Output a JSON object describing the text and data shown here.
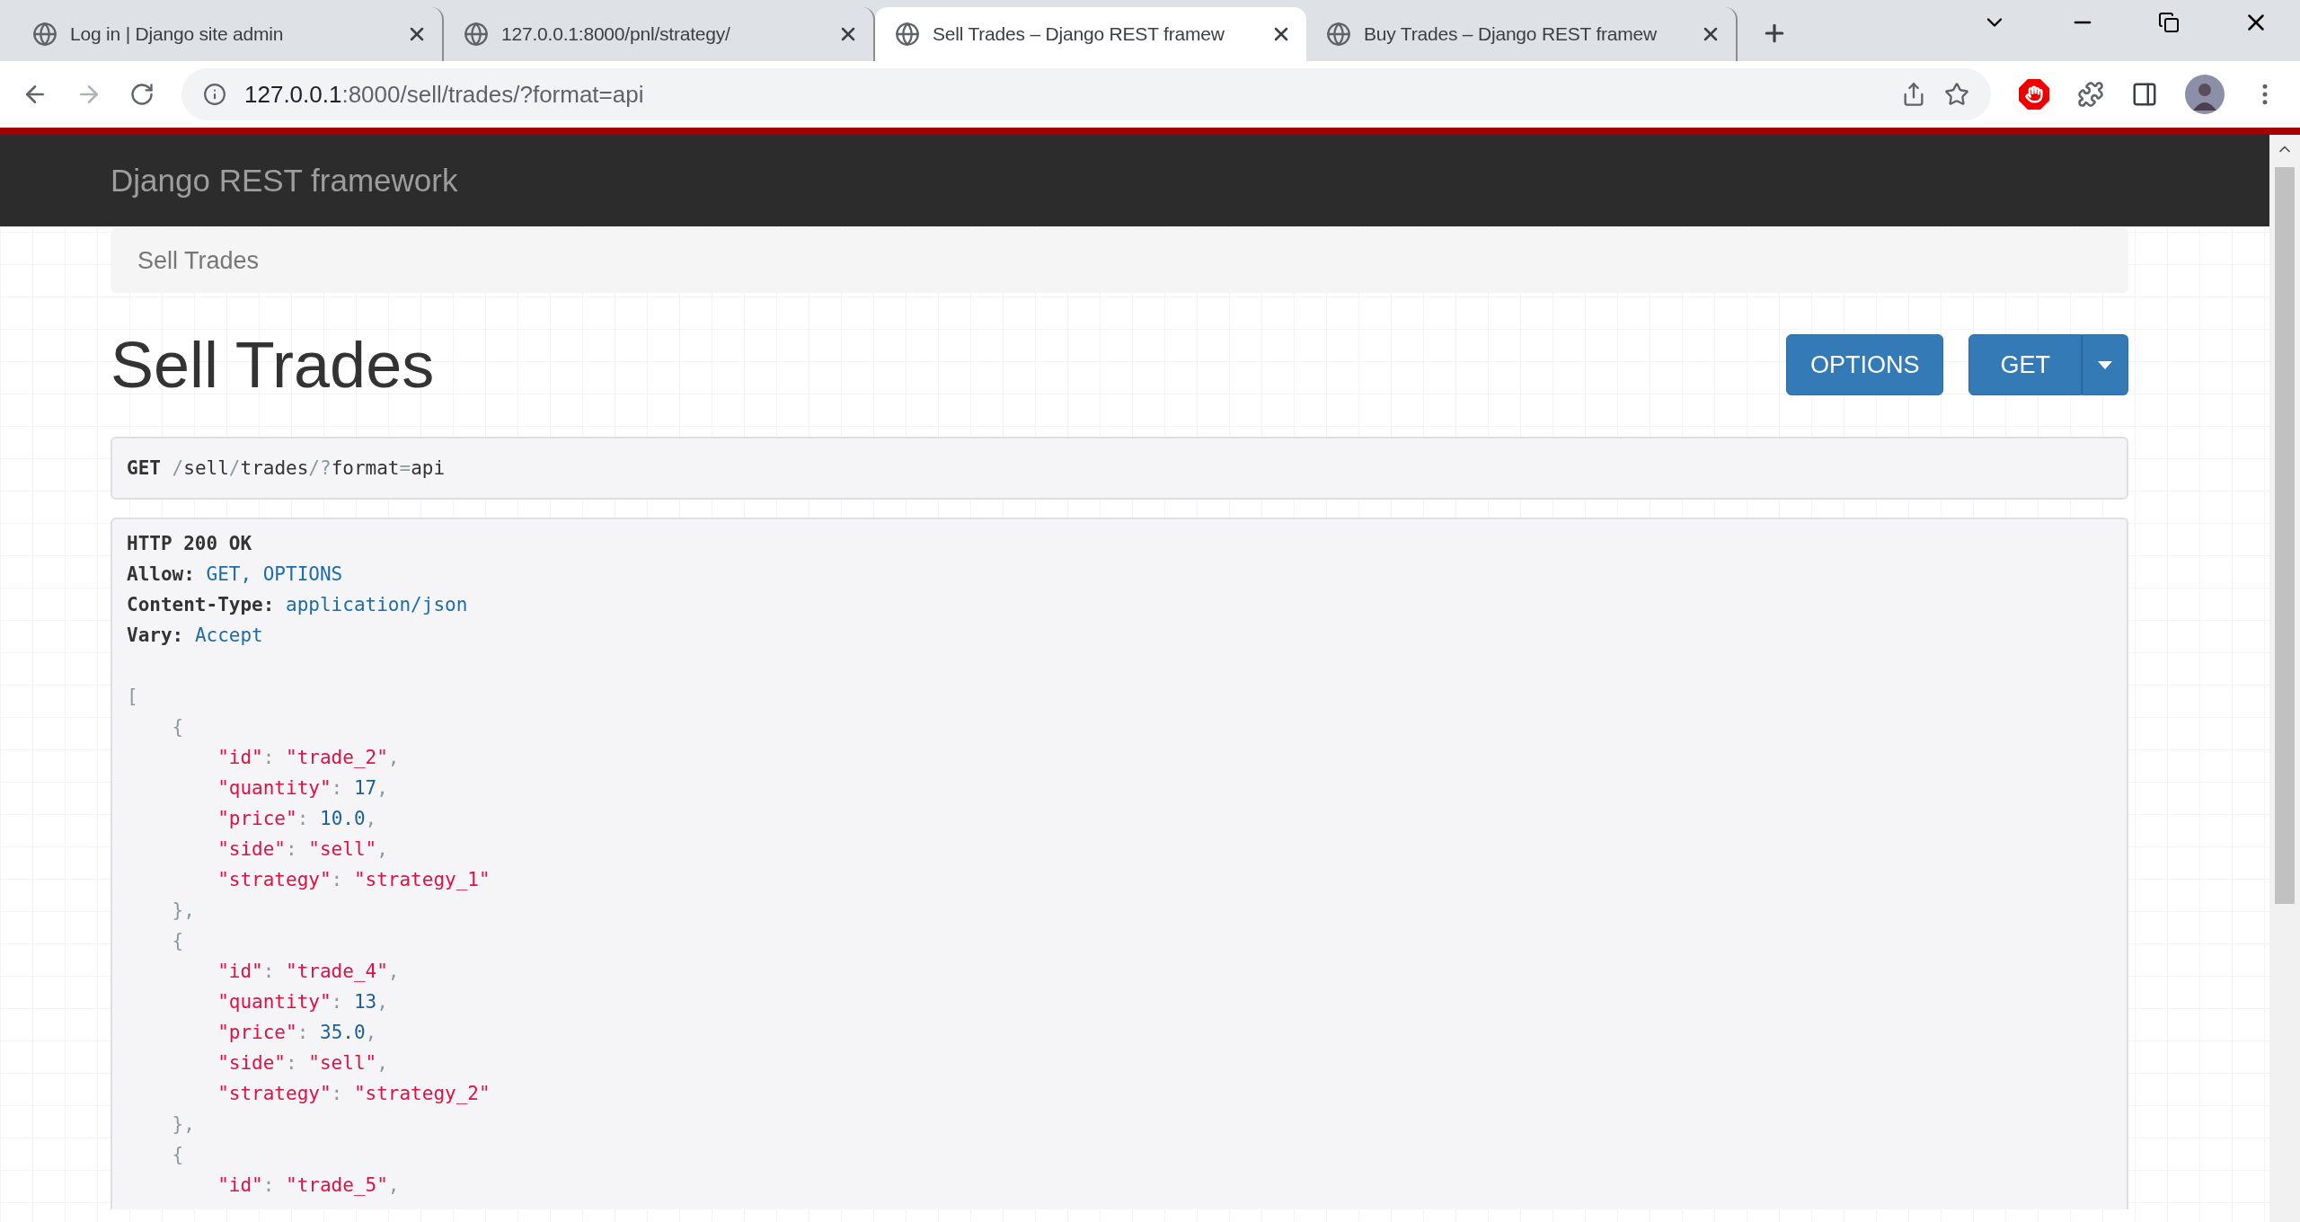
{
  "browser": {
    "tabs": [
      {
        "title": "Log in | Django site admin",
        "selected": false
      },
      {
        "title": "127.0.0.1:8000/pnl/strategy/",
        "selected": false
      },
      {
        "title": "Sell Trades – Django REST framew",
        "selected": true
      },
      {
        "title": "Buy Trades – Django REST framew",
        "selected": false
      }
    ],
    "address": {
      "host": "127.0.0.1",
      "path": ":8000/sell/trades/?format=api"
    }
  },
  "navbar": {
    "brand": "Django REST framework"
  },
  "breadcrumb": [
    "Sell Trades"
  ],
  "page_title": "Sell Trades",
  "buttons": [
    {
      "label": "OPTIONS",
      "kind": "plain"
    },
    {
      "label": "GET",
      "kind": "split"
    }
  ],
  "request": {
    "method": "GET",
    "path": "/sell/trades/?format=api"
  },
  "response": {
    "status": "HTTP 200 OK",
    "headers": [
      {
        "name": "Allow:",
        "value": "GET, OPTIONS"
      },
      {
        "name": "Content-Type:",
        "value": "application/json"
      },
      {
        "name": "Vary:",
        "value": "Accept"
      }
    ],
    "body": {
      "open": "[",
      "items": [
        {
          "open": "{",
          "close": "},",
          "fields": [
            {
              "key": "\"id\"",
              "sep": ":",
              "value": "\"trade_2\"",
              "kind": "string",
              "end": ","
            },
            {
              "key": "\"quantity\"",
              "sep": ":",
              "value": "17",
              "kind": "number",
              "end": ","
            },
            {
              "key": "\"price\"",
              "sep": ":",
              "value": "10.0",
              "kind": "number",
              "end": ","
            },
            {
              "key": "\"side\"",
              "sep": ":",
              "value": "\"sell\"",
              "kind": "string",
              "end": ","
            },
            {
              "key": "\"strategy\"",
              "sep": ":",
              "value": "\"strategy_1\"",
              "kind": "string"
            }
          ]
        },
        {
          "open": "{",
          "close": "},",
          "fields": [
            {
              "key": "\"id\"",
              "sep": ":",
              "value": "\"trade_4\"",
              "kind": "string",
              "end": ","
            },
            {
              "key": "\"quantity\"",
              "sep": ":",
              "value": "13",
              "kind": "number",
              "end": ","
            },
            {
              "key": "\"price\"",
              "sep": ":",
              "value": "35.0",
              "kind": "number",
              "end": ","
            },
            {
              "key": "\"side\"",
              "sep": ":",
              "value": "\"sell\"",
              "kind": "string",
              "end": ","
            },
            {
              "key": "\"strategy\"",
              "sep": ":",
              "value": "\"strategy_2\"",
              "kind": "string"
            }
          ]
        },
        {
          "open": "{",
          "fields": [
            {
              "key": "\"id\"",
              "sep": ":",
              "value": "\"trade_5\"",
              "kind": "string",
              "end": ","
            }
          ]
        }
      ]
    }
  }
}
